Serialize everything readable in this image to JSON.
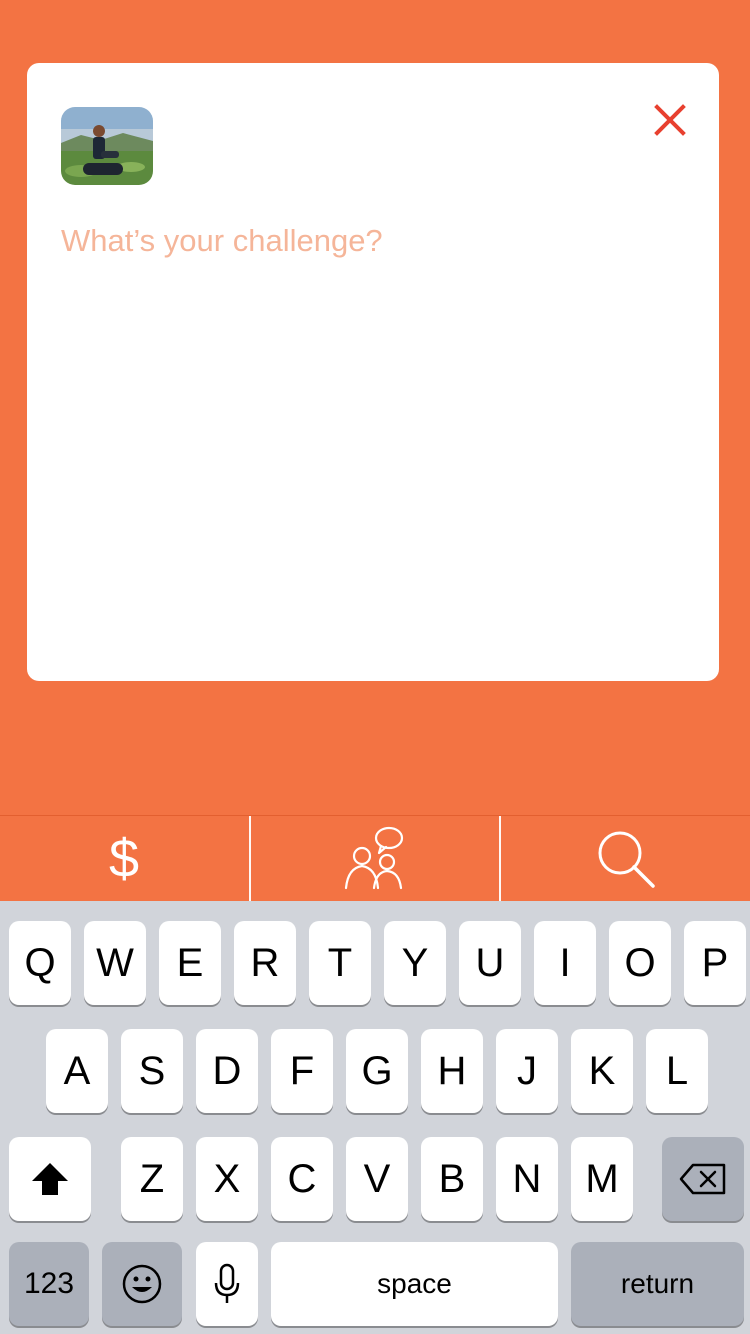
{
  "compose": {
    "placeholder": "What’s your challenge?",
    "input_value": ""
  },
  "toolbar": {
    "items": [
      {
        "icon": "dollar-icon"
      },
      {
        "icon": "people-chat-icon"
      },
      {
        "icon": "search-icon"
      }
    ]
  },
  "keyboard": {
    "row1": [
      "Q",
      "W",
      "E",
      "R",
      "T",
      "Y",
      "U",
      "I",
      "O",
      "P"
    ],
    "row2": [
      "A",
      "S",
      "D",
      "F",
      "G",
      "H",
      "J",
      "K",
      "L"
    ],
    "row3": [
      "Z",
      "X",
      "C",
      "V",
      "B",
      "N",
      "M"
    ],
    "numbers_label": "123",
    "space_label": "space",
    "return_label": "return"
  },
  "colors": {
    "background": "#F37343",
    "close": "#E8402F",
    "placeholder": "#F5B599",
    "keyboard_bg": "#D1D4DA"
  }
}
